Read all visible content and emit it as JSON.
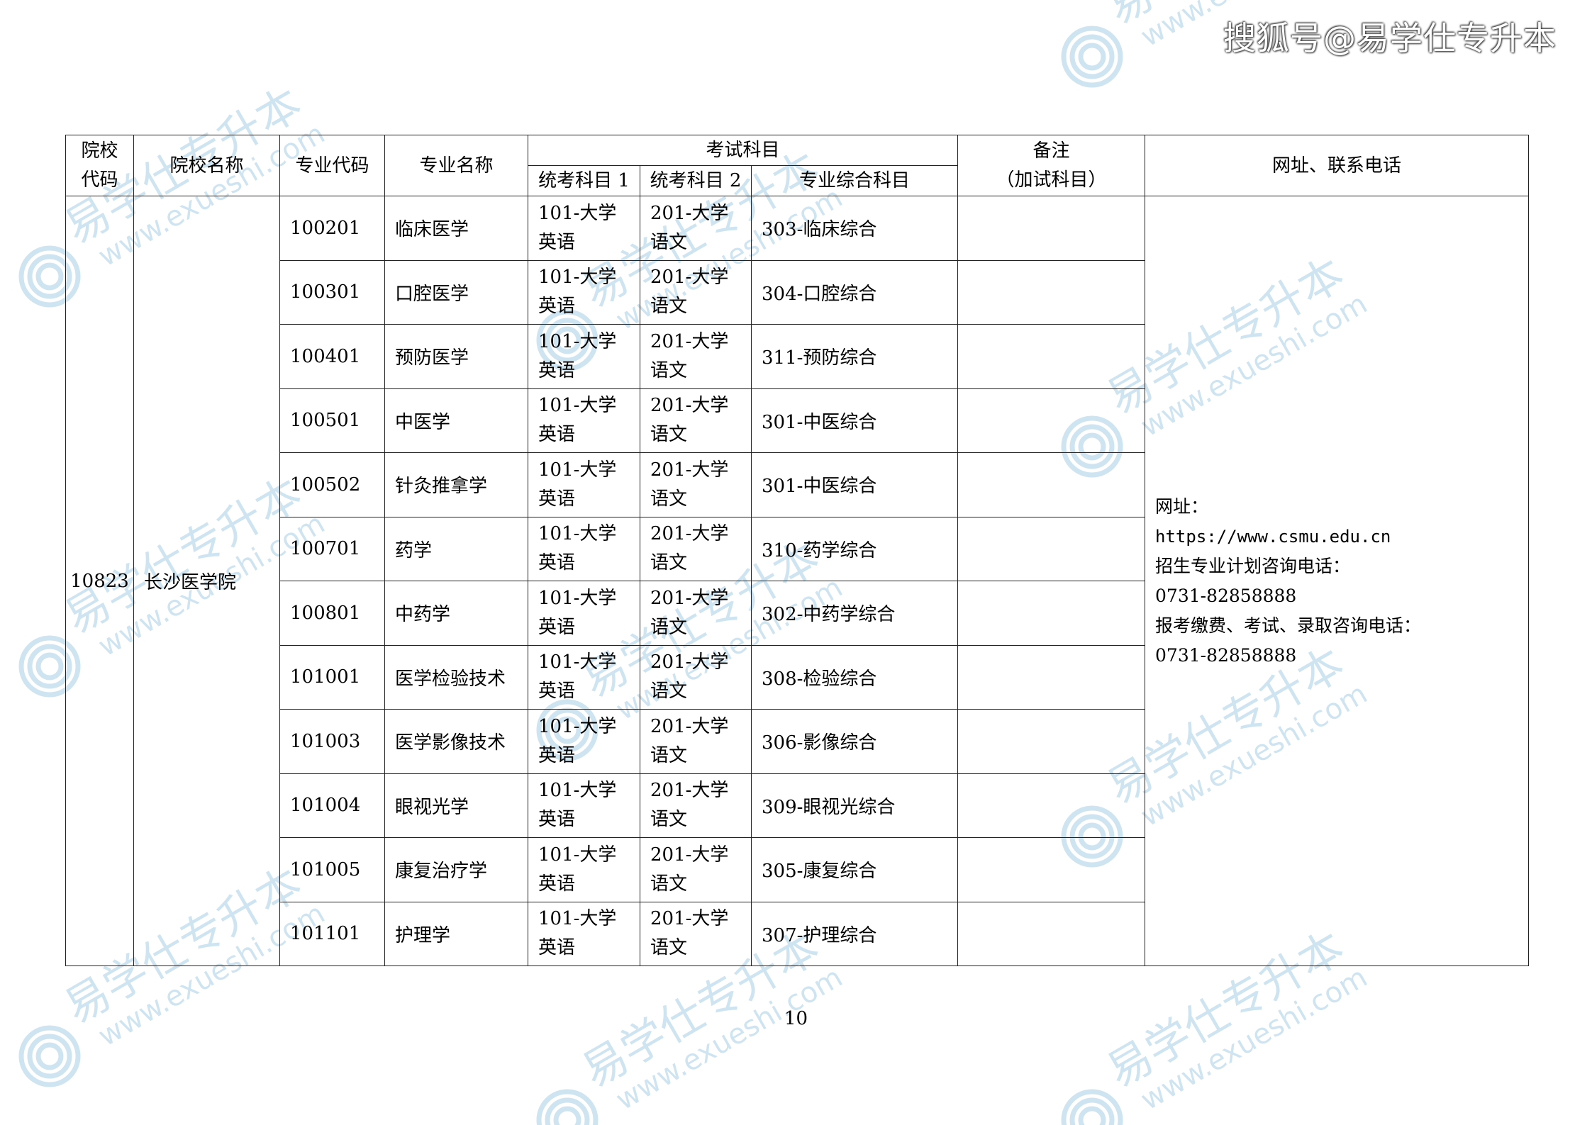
{
  "header": {
    "source": "搜狐号@易学仕专升本"
  },
  "watermark": {
    "brand": "易学仕专升本",
    "site": "www.exueshi.com",
    "color": "#7fb9d9"
  },
  "table": {
    "headers": {
      "school_code": "院校\n代码",
      "school_name": "院校名称",
      "major_code": "专业代码",
      "major_name": "专业名称",
      "exam_subjects": "考试科目",
      "subject1": "统考科目 1",
      "subject2": "统考科目 2",
      "subject3": "专业综合科目",
      "remarks": "备注\n（加试科目）",
      "contact": "网址、联系电话"
    },
    "school_code": "10823",
    "school_name": "长沙医学院",
    "rows": [
      {
        "code": "100201",
        "name": "临床医学",
        "s1": "101-大学\n英语",
        "s2": "201-大学\n语文",
        "s3": "303-临床综合",
        "remark": ""
      },
      {
        "code": "100301",
        "name": "口腔医学",
        "s1": "101-大学\n英语",
        "s2": "201-大学\n语文",
        "s3": "304-口腔综合",
        "remark": ""
      },
      {
        "code": "100401",
        "name": "预防医学",
        "s1": "101-大学\n英语",
        "s2": "201-大学\n语文",
        "s3": "311-预防综合",
        "remark": ""
      },
      {
        "code": "100501",
        "name": "中医学",
        "s1": "101-大学\n英语",
        "s2": "201-大学\n语文",
        "s3": "301-中医综合",
        "remark": ""
      },
      {
        "code": "100502",
        "name": "针灸推拿学",
        "s1": "101-大学\n英语",
        "s2": "201-大学\n语文",
        "s3": "301-中医综合",
        "remark": ""
      },
      {
        "code": "100701",
        "name": "药学",
        "s1": "101-大学\n英语",
        "s2": "201-大学\n语文",
        "s3": "310-药学综合",
        "remark": ""
      },
      {
        "code": "100801",
        "name": "中药学",
        "s1": "101-大学\n英语",
        "s2": "201-大学\n语文",
        "s3": "302-中药学综合",
        "remark": ""
      },
      {
        "code": "101001",
        "name": "医学检验技术",
        "s1": "101-大学\n英语",
        "s2": "201-大学\n语文",
        "s3": "308-检验综合",
        "remark": ""
      },
      {
        "code": "101003",
        "name": "医学影像技术",
        "s1": "101-大学\n英语",
        "s2": "201-大学\n语文",
        "s3": "306-影像综合",
        "remark": ""
      },
      {
        "code": "101004",
        "name": "眼视光学",
        "s1": "101-大学\n英语",
        "s2": "201-大学\n语文",
        "s3": "309-眼视光综合",
        "remark": ""
      },
      {
        "code": "101005",
        "name": "康复治疗学",
        "s1": "101-大学\n英语",
        "s2": "201-大学\n语文",
        "s3": "305-康复综合",
        "remark": ""
      },
      {
        "code": "101101",
        "name": "护理学",
        "s1": "101-大学\n英语",
        "s2": "201-大学\n语文",
        "s3": "307-护理综合",
        "remark": ""
      }
    ],
    "contact": {
      "url_label": "网址：",
      "url": "https://www.csmu.edu.cn",
      "plan_phone_label": "招生专业计划咨询电话：",
      "plan_phone": "0731-82858888",
      "exam_phone_label": "报考缴费、考试、录取咨询电话：",
      "exam_phone": "0731-82858888"
    }
  },
  "footer": {
    "page_number": "10"
  }
}
